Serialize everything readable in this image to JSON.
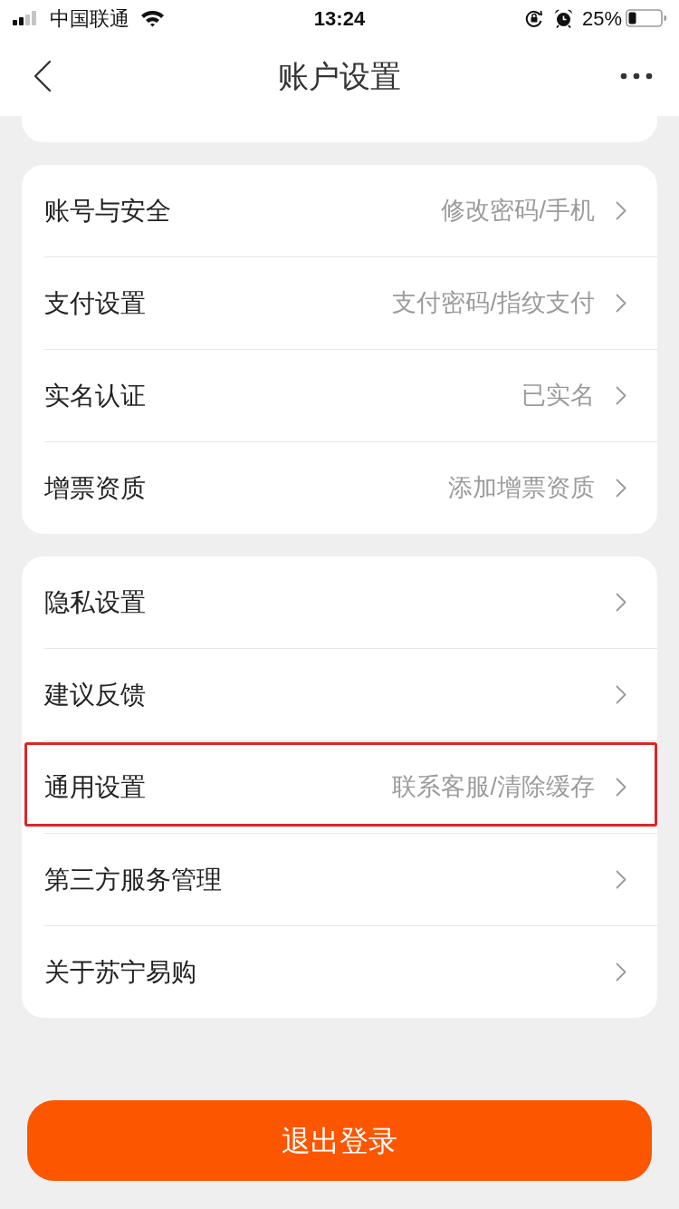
{
  "status_bar": {
    "carrier": "中国联通",
    "time": "13:24",
    "battery": "25%"
  },
  "nav": {
    "title": "账户设置"
  },
  "sections": [
    {
      "items": [
        {
          "label": "账号与安全",
          "value": "修改密码/手机",
          "highlighted": false
        },
        {
          "label": "支付设置",
          "value": "支付密码/指纹支付",
          "highlighted": false
        },
        {
          "label": "实名认证",
          "value": "已实名",
          "highlighted": false
        },
        {
          "label": "增票资质",
          "value": "添加增票资质",
          "highlighted": false
        }
      ]
    },
    {
      "items": [
        {
          "label": "隐私设置",
          "highlighted": false
        },
        {
          "label": "建议反馈",
          "highlighted": false
        },
        {
          "label": "通用设置",
          "value": "联系客服/清除缓存",
          "highlighted": true
        },
        {
          "label": "第三方服务管理",
          "highlighted": false
        },
        {
          "label": "关于苏宁易购",
          "highlighted": false
        }
      ]
    }
  ],
  "logout_button": "退出登录"
}
